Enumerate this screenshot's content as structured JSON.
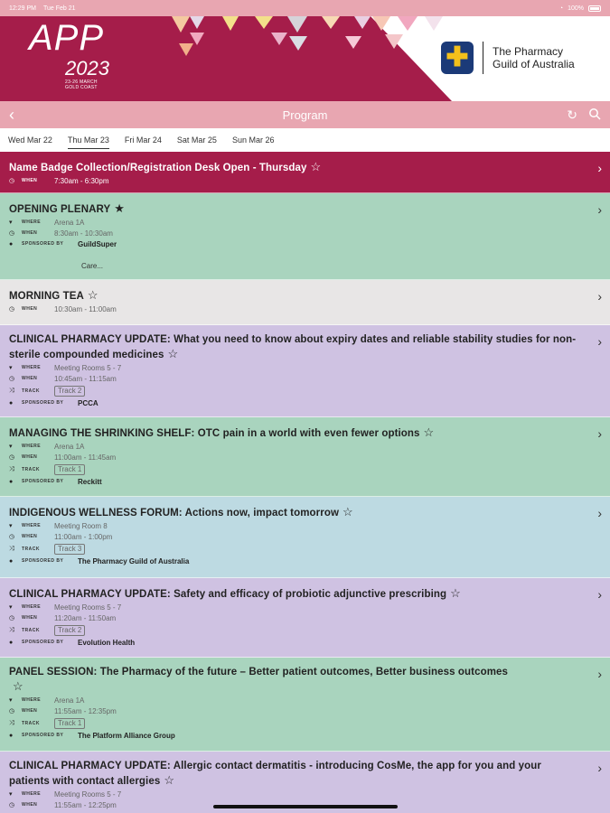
{
  "status_bar": {
    "time": "12:29 PM",
    "date": "Tue Feb 21",
    "battery": "100%"
  },
  "banner": {
    "app_logo": "APP",
    "year": "2023",
    "event_dates": "23-26 MARCH",
    "event_location": "GOLD COAST",
    "guild_line1": "The Pharmacy",
    "guild_line2": "Guild of Australia",
    "colors": {
      "brand": "#a51d4a",
      "accent_pink": "#e8a6b1"
    }
  },
  "nav": {
    "title": "Program",
    "back_icon": "chevron-left-icon",
    "refresh_icon": "refresh-icon",
    "search_icon": "search-icon"
  },
  "days": [
    {
      "label": "Wed Mar 22"
    },
    {
      "label": "Thu Mar 23",
      "active": true
    },
    {
      "label": "Fri Mar 24"
    },
    {
      "label": "Sat Mar 25"
    },
    {
      "label": "Sun Mar 26"
    }
  ],
  "labels": {
    "where": "WHERE",
    "when": "WHEN",
    "track": "TRACK",
    "sponsored_by": "SPONSORED BY"
  },
  "sessions": [
    {
      "title": "Name Badge Collection/Registration Desk Open - Thursday",
      "when": "7:30am - 6:30pm"
    },
    {
      "title": "OPENING PLENARY",
      "where": "Arena 1A",
      "when": "8:30am - 10:30am",
      "sponsor": "GuildSuper",
      "extra": "Care..."
    },
    {
      "title": "MORNING TEA",
      "when": "10:30am - 11:00am"
    },
    {
      "title": "CLINICAL PHARMACY UPDATE: What you need to know about expiry dates and reliable stability studies for non-sterile compounded medicines",
      "where": "Meeting Rooms 5 - 7",
      "when": "10:45am - 11:15am",
      "track": "Track 2",
      "sponsor": "PCCA"
    },
    {
      "title": "MANAGING THE SHRINKING SHELF: OTC pain in a world with even fewer options",
      "where": "Arena 1A",
      "when": "11:00am - 11:45am",
      "track": "Track 1",
      "sponsor": "Reckitt"
    },
    {
      "title": "INDIGENOUS WELLNESS FORUM: Actions now, impact tomorrow",
      "where": "Meeting Room 8",
      "when": "11:00am - 1:00pm",
      "track": "Track 3",
      "sponsor": "The Pharmacy Guild of Australia"
    },
    {
      "title": "CLINICAL PHARMACY UPDATE: Safety and efficacy of probiotic adjunctive prescribing",
      "where": "Meeting Rooms 5 - 7",
      "when": "11:20am - 11:50am",
      "track": "Track 2",
      "sponsor": "Evolution Health"
    },
    {
      "title": "PANEL SESSION: The Pharmacy of the future – Better patient outcomes, Better business outcomes",
      "where": "Arena 1A",
      "when": "11:55am - 12:35pm",
      "track": "Track 1",
      "sponsor": "The Platform Alliance Group"
    },
    {
      "title": "CLINICAL PHARMACY UPDATE: Allergic contact dermatitis - introducing CosMe, the app for you and your patients with contact allergies",
      "where": "Meeting Rooms 5 - 7",
      "when": "11:55am - 12:25pm"
    }
  ]
}
